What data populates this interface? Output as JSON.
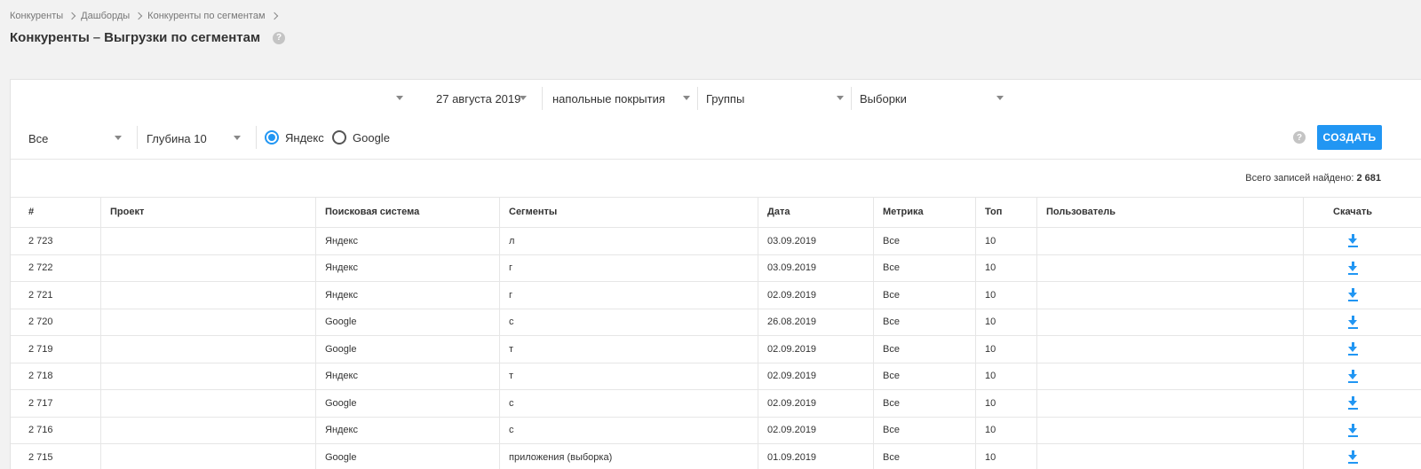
{
  "breadcrumb": [
    "Конкуренты",
    "Дашборды",
    "Конкуренты по сегментам"
  ],
  "title": {
    "strong": "Конкуренты",
    "dash": "–",
    "rest": "Выгрузки по сегментам"
  },
  "filters": {
    "date": "27 августа 2019",
    "category": "напольные покрытия",
    "groups": "Группы",
    "samples": "Выборки",
    "scope": "Все",
    "depth": "Глубина 10",
    "engine_options": [
      "Яндекс",
      "Google"
    ],
    "engine_selected": "Яндекс"
  },
  "create_label": "СОЗДАТЬ",
  "total": {
    "label": "Всего записей найдено:",
    "value": "2 681"
  },
  "columns": [
    "#",
    "Проект",
    "Поисковая система",
    "Сегменты",
    "Дата",
    "Метрика",
    "Топ",
    "Пользователь",
    "Скачать"
  ],
  "rows": [
    {
      "id": "2 723",
      "project": "",
      "engine": "Яндекс",
      "segment": "л",
      "date": "03.09.2019",
      "metric": "Все",
      "top": "10",
      "user": ""
    },
    {
      "id": "2 722",
      "project": "",
      "engine": "Яндекс",
      "segment": "г",
      "date": "03.09.2019",
      "metric": "Все",
      "top": "10",
      "user": ""
    },
    {
      "id": "2 721",
      "project": "",
      "engine": "Яндекс",
      "segment": "г",
      "date": "02.09.2019",
      "metric": "Все",
      "top": "10",
      "user": ""
    },
    {
      "id": "2 720",
      "project": "",
      "engine": "Google",
      "segment": "с",
      "date": "26.08.2019",
      "metric": "Все",
      "top": "10",
      "user": ""
    },
    {
      "id": "2 719",
      "project": "",
      "engine": "Google",
      "segment": "т",
      "date": "02.09.2019",
      "metric": "Все",
      "top": "10",
      "user": ""
    },
    {
      "id": "2 718",
      "project": "",
      "engine": "Яндекс",
      "segment": "т",
      "date": "02.09.2019",
      "metric": "Все",
      "top": "10",
      "user": ""
    },
    {
      "id": "2 717",
      "project": "",
      "engine": "Google",
      "segment": "с",
      "date": "02.09.2019",
      "metric": "Все",
      "top": "10",
      "user": ""
    },
    {
      "id": "2 716",
      "project": "",
      "engine": "Яндекс",
      "segment": "с",
      "date": "02.09.2019",
      "metric": "Все",
      "top": "10",
      "user": ""
    },
    {
      "id": "2 715",
      "project": "",
      "engine": "Google",
      "segment": "приложения (выборка)",
      "date": "01.09.2019",
      "metric": "Все",
      "top": "10",
      "user": ""
    }
  ],
  "colors": {
    "accent": "#2196f3",
    "page_bg": "#f2f2f2",
    "card_bg": "#ffffff"
  },
  "icons": {
    "breadcrumb_sep": "chevron-right-icon",
    "help": "help-icon",
    "download": "download-icon"
  }
}
